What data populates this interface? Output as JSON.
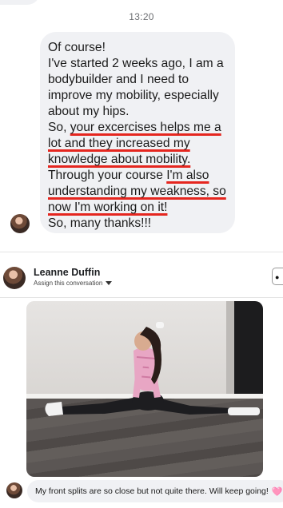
{
  "conversation": {
    "timestamp": "13:20",
    "message": {
      "lines": [
        {
          "text": "Of course!"
        },
        {
          "text": "I've started 2 weeks ago, I am a"
        },
        {
          "text": "bodybuilder and I need to"
        },
        {
          "text": "improve my mobility, especially"
        },
        {
          "text": "about my hips."
        },
        {
          "pre": "So, ",
          "underlined": "your excercises helps me a"
        },
        {
          "underlined": "lot and they increased my"
        },
        {
          "underlined": "knowledge about mobility."
        },
        {
          "pre": "Through your course ",
          "underlined": "I'm also"
        },
        {
          "underlined": "understanding my weakness, so"
        },
        {
          "underlined": "now I'm working on it!"
        },
        {
          "text": "So, many thanks!!!"
        }
      ],
      "underline_color": "#e5261f"
    },
    "sender": {
      "name": "Leanne Duffin",
      "assign_label": "Assign this conversation"
    },
    "photo": {
      "icon": "photo-split-stretch"
    },
    "caption": {
      "text": "My front splits are so close but not quite there. Will keep going!",
      "emoji": "🩷"
    }
  },
  "colors": {
    "bubble": "#f0f1f4",
    "accent_underline": "#e5261f"
  }
}
